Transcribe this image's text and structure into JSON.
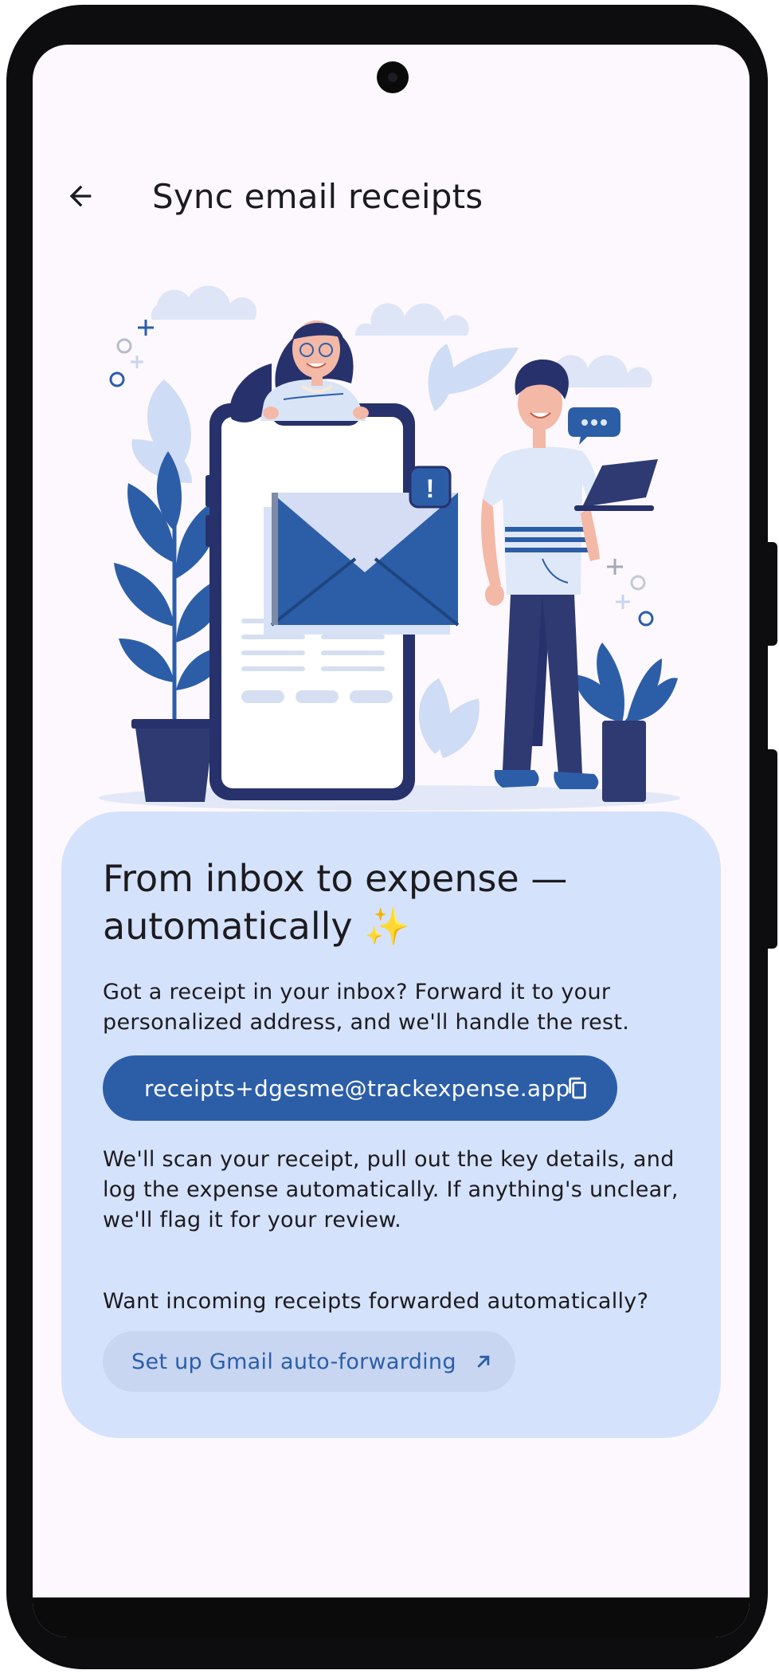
{
  "appbar": {
    "title": "Sync email receipts",
    "back_icon": "arrow-back-icon"
  },
  "card": {
    "title": "From inbox to expense — automatically ✨",
    "intro": "Got a receipt in your inbox? Forward it to your personalized address, and we'll handle the rest.",
    "address": "receipts+dgesme@trackexpense.app",
    "address_icon": "copy-icon",
    "description": "We'll scan your receipt, pull out the key details, and log the expense automatically. If anything's unclear, we'll flag it for your review.",
    "forward_prompt": "Want incoming receipts forwarded automatically?",
    "gmail_button": "Set up Gmail auto-forwarding",
    "gmail_icon": "open-in-new-icon",
    "notification_badge": "!"
  },
  "colors": {
    "accent": "#2c5ea8",
    "card_bg": "#d5e2fb",
    "screen_bg": "#fdf8fd",
    "navy": "#27316b"
  }
}
